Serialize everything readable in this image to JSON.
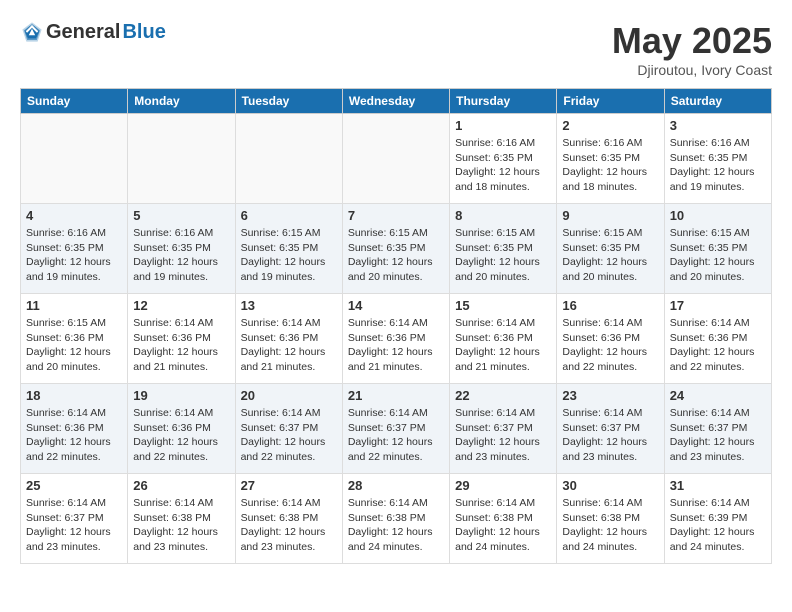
{
  "logo": {
    "general": "General",
    "blue": "Blue"
  },
  "title": "May 2025",
  "subtitle": "Djiroutou, Ivory Coast",
  "days_of_week": [
    "Sunday",
    "Monday",
    "Tuesday",
    "Wednesday",
    "Thursday",
    "Friday",
    "Saturday"
  ],
  "weeks": [
    {
      "alt": false,
      "days": [
        {
          "num": "",
          "info": ""
        },
        {
          "num": "",
          "info": ""
        },
        {
          "num": "",
          "info": ""
        },
        {
          "num": "",
          "info": ""
        },
        {
          "num": "1",
          "info": "Sunrise: 6:16 AM\nSunset: 6:35 PM\nDaylight: 12 hours\nand 18 minutes."
        },
        {
          "num": "2",
          "info": "Sunrise: 6:16 AM\nSunset: 6:35 PM\nDaylight: 12 hours\nand 18 minutes."
        },
        {
          "num": "3",
          "info": "Sunrise: 6:16 AM\nSunset: 6:35 PM\nDaylight: 12 hours\nand 19 minutes."
        }
      ]
    },
    {
      "alt": true,
      "days": [
        {
          "num": "4",
          "info": "Sunrise: 6:16 AM\nSunset: 6:35 PM\nDaylight: 12 hours\nand 19 minutes."
        },
        {
          "num": "5",
          "info": "Sunrise: 6:16 AM\nSunset: 6:35 PM\nDaylight: 12 hours\nand 19 minutes."
        },
        {
          "num": "6",
          "info": "Sunrise: 6:15 AM\nSunset: 6:35 PM\nDaylight: 12 hours\nand 19 minutes."
        },
        {
          "num": "7",
          "info": "Sunrise: 6:15 AM\nSunset: 6:35 PM\nDaylight: 12 hours\nand 20 minutes."
        },
        {
          "num": "8",
          "info": "Sunrise: 6:15 AM\nSunset: 6:35 PM\nDaylight: 12 hours\nand 20 minutes."
        },
        {
          "num": "9",
          "info": "Sunrise: 6:15 AM\nSunset: 6:35 PM\nDaylight: 12 hours\nand 20 minutes."
        },
        {
          "num": "10",
          "info": "Sunrise: 6:15 AM\nSunset: 6:35 PM\nDaylight: 12 hours\nand 20 minutes."
        }
      ]
    },
    {
      "alt": false,
      "days": [
        {
          "num": "11",
          "info": "Sunrise: 6:15 AM\nSunset: 6:36 PM\nDaylight: 12 hours\nand 20 minutes."
        },
        {
          "num": "12",
          "info": "Sunrise: 6:14 AM\nSunset: 6:36 PM\nDaylight: 12 hours\nand 21 minutes."
        },
        {
          "num": "13",
          "info": "Sunrise: 6:14 AM\nSunset: 6:36 PM\nDaylight: 12 hours\nand 21 minutes."
        },
        {
          "num": "14",
          "info": "Sunrise: 6:14 AM\nSunset: 6:36 PM\nDaylight: 12 hours\nand 21 minutes."
        },
        {
          "num": "15",
          "info": "Sunrise: 6:14 AM\nSunset: 6:36 PM\nDaylight: 12 hours\nand 21 minutes."
        },
        {
          "num": "16",
          "info": "Sunrise: 6:14 AM\nSunset: 6:36 PM\nDaylight: 12 hours\nand 22 minutes."
        },
        {
          "num": "17",
          "info": "Sunrise: 6:14 AM\nSunset: 6:36 PM\nDaylight: 12 hours\nand 22 minutes."
        }
      ]
    },
    {
      "alt": true,
      "days": [
        {
          "num": "18",
          "info": "Sunrise: 6:14 AM\nSunset: 6:36 PM\nDaylight: 12 hours\nand 22 minutes."
        },
        {
          "num": "19",
          "info": "Sunrise: 6:14 AM\nSunset: 6:36 PM\nDaylight: 12 hours\nand 22 minutes."
        },
        {
          "num": "20",
          "info": "Sunrise: 6:14 AM\nSunset: 6:37 PM\nDaylight: 12 hours\nand 22 minutes."
        },
        {
          "num": "21",
          "info": "Sunrise: 6:14 AM\nSunset: 6:37 PM\nDaylight: 12 hours\nand 22 minutes."
        },
        {
          "num": "22",
          "info": "Sunrise: 6:14 AM\nSunset: 6:37 PM\nDaylight: 12 hours\nand 23 minutes."
        },
        {
          "num": "23",
          "info": "Sunrise: 6:14 AM\nSunset: 6:37 PM\nDaylight: 12 hours\nand 23 minutes."
        },
        {
          "num": "24",
          "info": "Sunrise: 6:14 AM\nSunset: 6:37 PM\nDaylight: 12 hours\nand 23 minutes."
        }
      ]
    },
    {
      "alt": false,
      "days": [
        {
          "num": "25",
          "info": "Sunrise: 6:14 AM\nSunset: 6:37 PM\nDaylight: 12 hours\nand 23 minutes."
        },
        {
          "num": "26",
          "info": "Sunrise: 6:14 AM\nSunset: 6:38 PM\nDaylight: 12 hours\nand 23 minutes."
        },
        {
          "num": "27",
          "info": "Sunrise: 6:14 AM\nSunset: 6:38 PM\nDaylight: 12 hours\nand 23 minutes."
        },
        {
          "num": "28",
          "info": "Sunrise: 6:14 AM\nSunset: 6:38 PM\nDaylight: 12 hours\nand 24 minutes."
        },
        {
          "num": "29",
          "info": "Sunrise: 6:14 AM\nSunset: 6:38 PM\nDaylight: 12 hours\nand 24 minutes."
        },
        {
          "num": "30",
          "info": "Sunrise: 6:14 AM\nSunset: 6:38 PM\nDaylight: 12 hours\nand 24 minutes."
        },
        {
          "num": "31",
          "info": "Sunrise: 6:14 AM\nSunset: 6:39 PM\nDaylight: 12 hours\nand 24 minutes."
        }
      ]
    }
  ]
}
